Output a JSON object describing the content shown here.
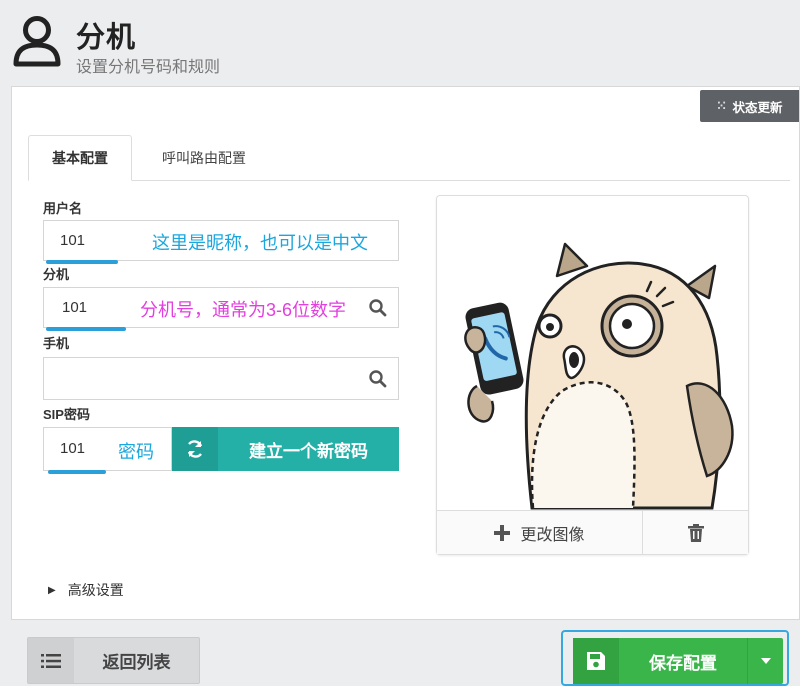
{
  "header": {
    "title": "分机",
    "subtitle": "设置分机号码和规则",
    "icon": "user-outline-icon"
  },
  "status_button": {
    "label": "状态更新",
    "icon": "spinner-icon"
  },
  "tabs": [
    {
      "label": "基本配置",
      "active": true
    },
    {
      "label": "呼叫路由配置",
      "active": false
    }
  ],
  "fields": {
    "username": {
      "label": "用户名",
      "value": "101",
      "hint": "这里是昵称，也可以是中文",
      "hint_color": "#1ba7dd"
    },
    "extension": {
      "label": "分机",
      "value": "101",
      "hint": "分机号，通常为3-6位数字",
      "hint_color": "#e33fe0"
    },
    "mobile": {
      "label": "手机",
      "value": ""
    },
    "sip_password": {
      "label": "SIP密码",
      "value": "101",
      "hint": "密码"
    }
  },
  "generate_password_button": {
    "label": "建立一个新密码",
    "icon": "refresh-icon",
    "color": "#25b0a7"
  },
  "avatar": {
    "change_label": "更改图像",
    "change_icon": "plus-icon",
    "delete_icon": "trash-icon"
  },
  "advanced": {
    "label": "高级设置"
  },
  "footer": {
    "back_button": {
      "label": "返回列表",
      "icon": "list-icon"
    },
    "save_button": {
      "label": "保存配置",
      "icon": "floppy-icon",
      "color": "#3ab54a"
    }
  }
}
